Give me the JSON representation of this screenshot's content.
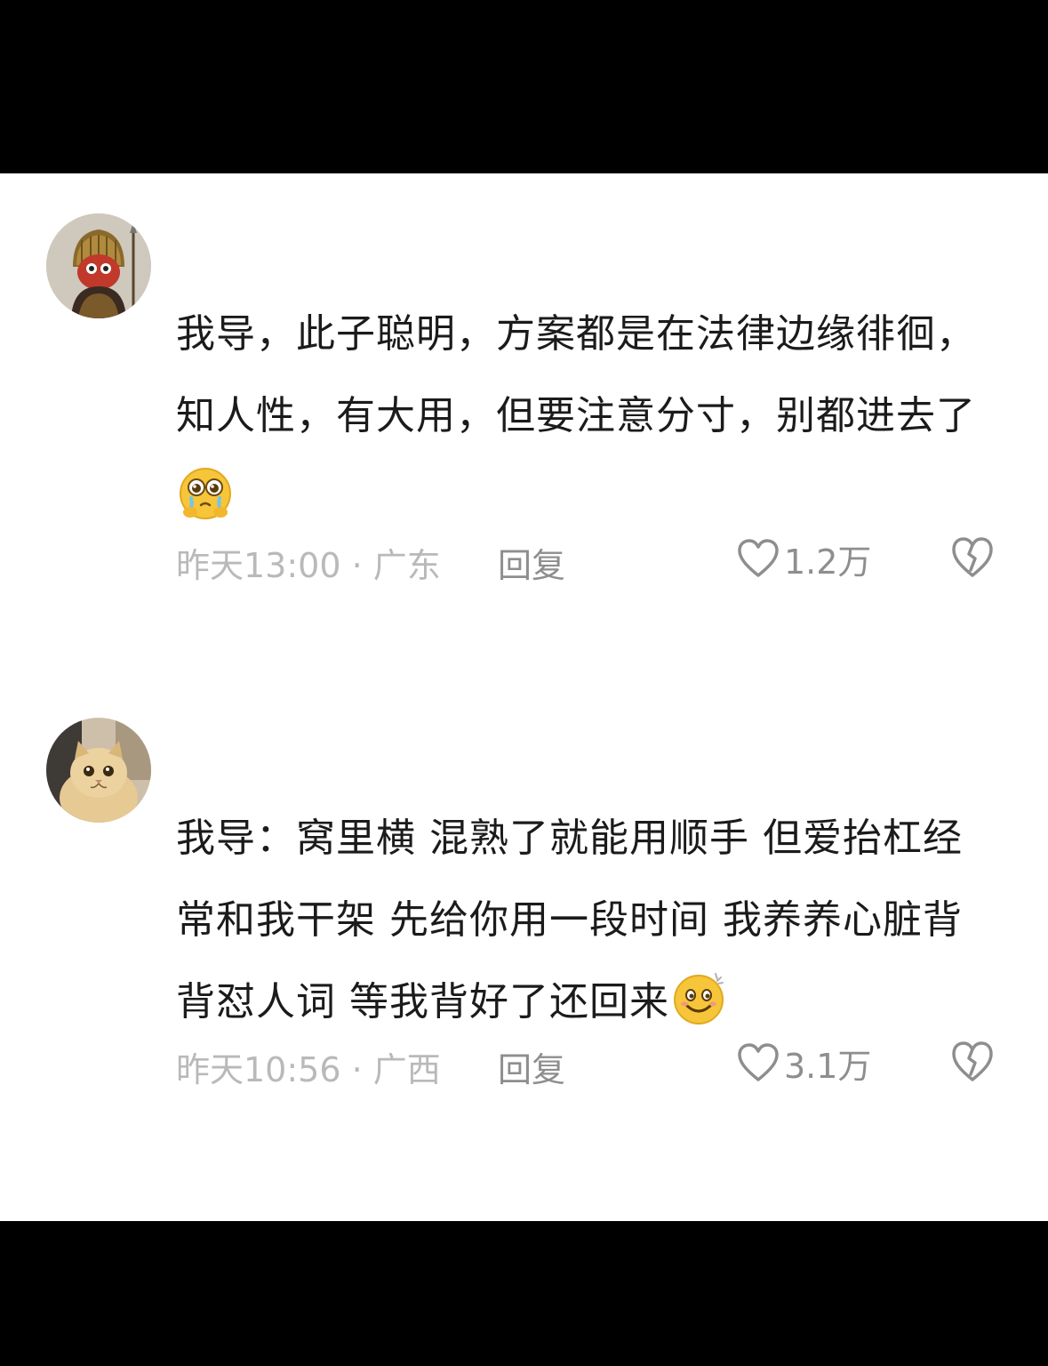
{
  "comments": [
    {
      "text": "我导，此子聪明，方案都是在法律边缘徘徊，知人性，有大用，但要注意分寸，别都进去了",
      "emoji": "pleading-face-emoji",
      "time": "昨天13:00",
      "location": "广东",
      "reply_label": "回复",
      "likes": "1.2万",
      "avatar": "helmet-figure-avatar"
    },
    {
      "text": "我导：窝里横 混熟了就能用顺手 但爱抬杠经常和我干架 先给你用一段时间 我养养心脏背背怼人词 等我背好了还回来",
      "emoji": "smiling-face-emoji",
      "time": "昨天10:56",
      "location": "广西",
      "reply_label": "回复",
      "likes": "3.1万",
      "avatar": "cat-avatar"
    }
  ],
  "separator": " · ",
  "colors": {
    "text": "#1b1b1b",
    "meta": "#b9b9b9",
    "action": "#8e8e8e",
    "background": "#ffffff",
    "frame": "#000000"
  }
}
